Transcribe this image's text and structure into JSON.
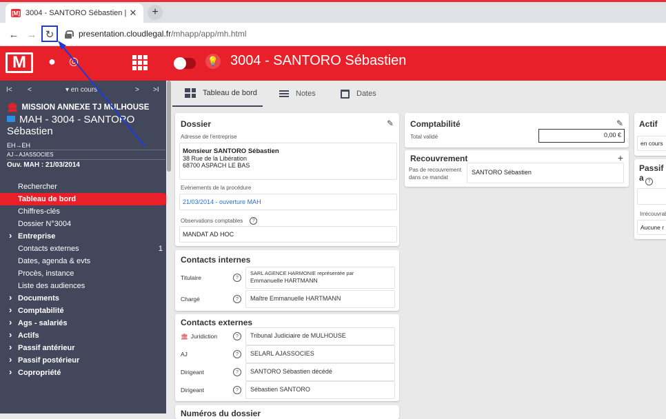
{
  "browser": {
    "tab_title": "3004 - SANTORO Sébastien | Tab",
    "favicon_text": "[M]",
    "url_host": "presentation.cloudlegal.fr",
    "url_path": "/mhapp/app/mh.html"
  },
  "header": {
    "logo_text": "[M]",
    "title": "3004 - SANTORO Sébastien"
  },
  "sidebar": {
    "pager": {
      "first": "I<",
      "prev": "<",
      "filter": "▾ en cours",
      "next": ">",
      "last": ">I"
    },
    "mission": "MISSION ANNEXE TJ MULHOUSE",
    "mah_title": "MAH - 3004 - SANTORO Sébastien",
    "eh": "EH→EH",
    "aj": "AJ→AJASSOCIES",
    "ouv": "Ouv. MAH : 21/03/2014",
    "menu": [
      {
        "label": "Rechercher"
      },
      {
        "label": "Tableau de bord"
      },
      {
        "label": "Chiffres-clés"
      },
      {
        "label": "Dossier N°3004"
      },
      {
        "label": "Entreprise"
      },
      {
        "label": "Contacts externes",
        "count": "1"
      },
      {
        "label": "Dates, agenda & evts"
      },
      {
        "label": "Procès, instance"
      },
      {
        "label": "Liste des audiences"
      },
      {
        "label": "Documents"
      },
      {
        "label": "Comptabilité"
      },
      {
        "label": "Ags - salariés"
      },
      {
        "label": "Actifs"
      },
      {
        "label": "Passif antérieur"
      },
      {
        "label": "Passif postérieur"
      },
      {
        "label": "Copropriété"
      }
    ]
  },
  "tabs": [
    {
      "label": "Tableau de bord"
    },
    {
      "label": "Notes"
    },
    {
      "label": "Dates"
    }
  ],
  "dossier": {
    "title": "Dossier",
    "adresse_label": "Adresse de l'entreprise",
    "name": "Monsieur SANTORO Sébastien",
    "street": "38 Rue de la Libération",
    "city": "68700 ASPACH LE BAS",
    "events_label": "Evènements de la procédure",
    "event": "21/03/2014 - ouverture MAH",
    "obs_label": "Observations comptables",
    "obs_value": "MANDAT AD HOC"
  },
  "contacts_internes": {
    "title": "Contacts internes",
    "rows": [
      {
        "label": "Titulaire",
        "value_line1": "SARL AGENCE HARMONIE représentée par",
        "value_line2": "Emmanuelle HARTMANN"
      },
      {
        "label": "Chargé",
        "value": "Maître Emmanuelle HARTMANN"
      }
    ]
  },
  "contacts_externes": {
    "title": "Contacts externes",
    "rows": [
      {
        "label": "Juridiction",
        "value": "Tribunal Judiciaire de MULHOUSE"
      },
      {
        "label": "AJ",
        "value": "SELARL AJASSOCIES"
      },
      {
        "label": "Dirigeant",
        "value": "SANTORO Sébastien décédé"
      },
      {
        "label": "Dirigeant",
        "value": "Sébastien SANTORO"
      }
    ]
  },
  "numeros": {
    "title": "Numéros du dossier"
  },
  "comptabilite": {
    "title": "Comptabilité",
    "total_label": "Total validé",
    "total_value": "0,00 €"
  },
  "recouvrement": {
    "title": "Recouvrement",
    "plus": "+",
    "empty_label": "Pas de recouvrement dans ce mandat",
    "value": "SANTORO Sébastien"
  },
  "actif": {
    "title": "Actif",
    "value": "en cours"
  },
  "passif": {
    "title": "Passif a",
    "irrec_label": "Irrécouvrab",
    "aucune": "Aucune r"
  }
}
